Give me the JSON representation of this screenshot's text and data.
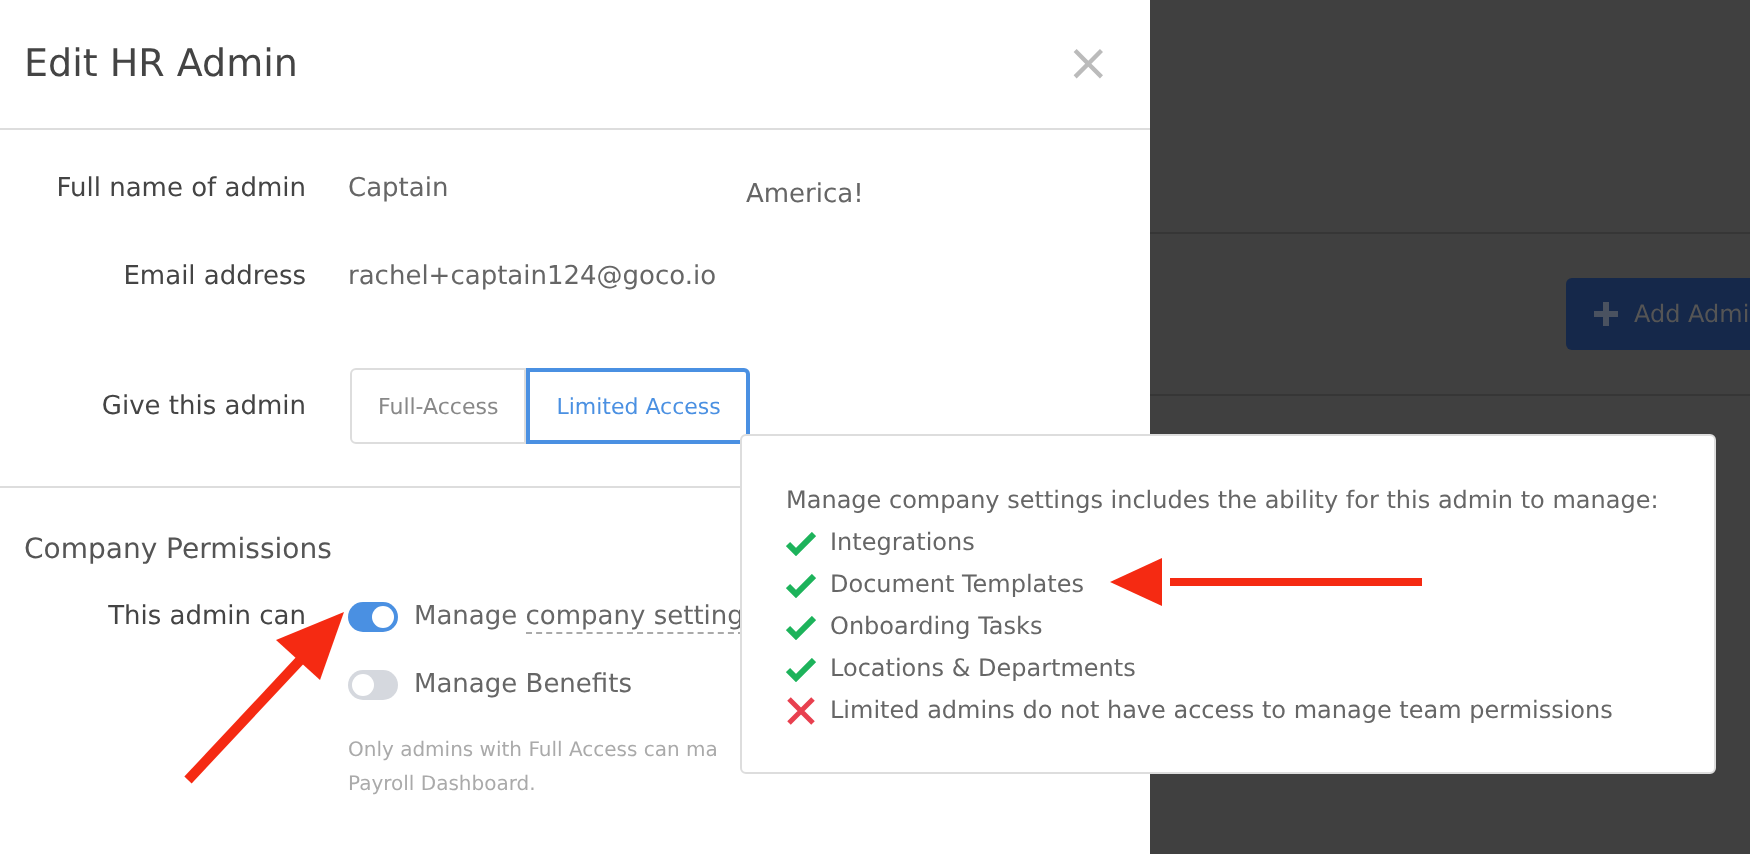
{
  "modal": {
    "title": "Edit HR Admin",
    "close": "×",
    "fields": [
      {
        "label": "Full name of admin",
        "value": "Captain",
        "value_2": "America!"
      },
      {
        "label": "Email address",
        "value": "rachel+captain124@goco.io"
      }
    ],
    "access": {
      "label": "Give this admin",
      "options": [
        {
          "label": "Full-Access",
          "selected": false
        },
        {
          "label": "Limited Access",
          "selected": true
        }
      ]
    },
    "permissions": {
      "heading": "Company Permissions",
      "label": "This admin can",
      "toggles": [
        {
          "prefix": "Manage ",
          "link": "company setting",
          "on": true
        },
        {
          "prefix": "Manage Benefits",
          "on": false
        }
      ],
      "note_lines": [
        "Only admins with Full Access can ma",
        "Payroll Dashboard."
      ]
    }
  },
  "background": {
    "button": "Add Admi"
  },
  "tooltip": {
    "intro": "Manage company settings includes the ability for this admin to manage:",
    "items": [
      {
        "text": "Integrations",
        "allowed": true
      },
      {
        "text": "Document Templates",
        "allowed": true
      },
      {
        "text": "Onboarding Tasks",
        "allowed": true
      },
      {
        "text": "Locations & Departments",
        "allowed": true
      },
      {
        "text": "Limited admins do not have access to manage team permissions",
        "allowed": false
      }
    ]
  }
}
